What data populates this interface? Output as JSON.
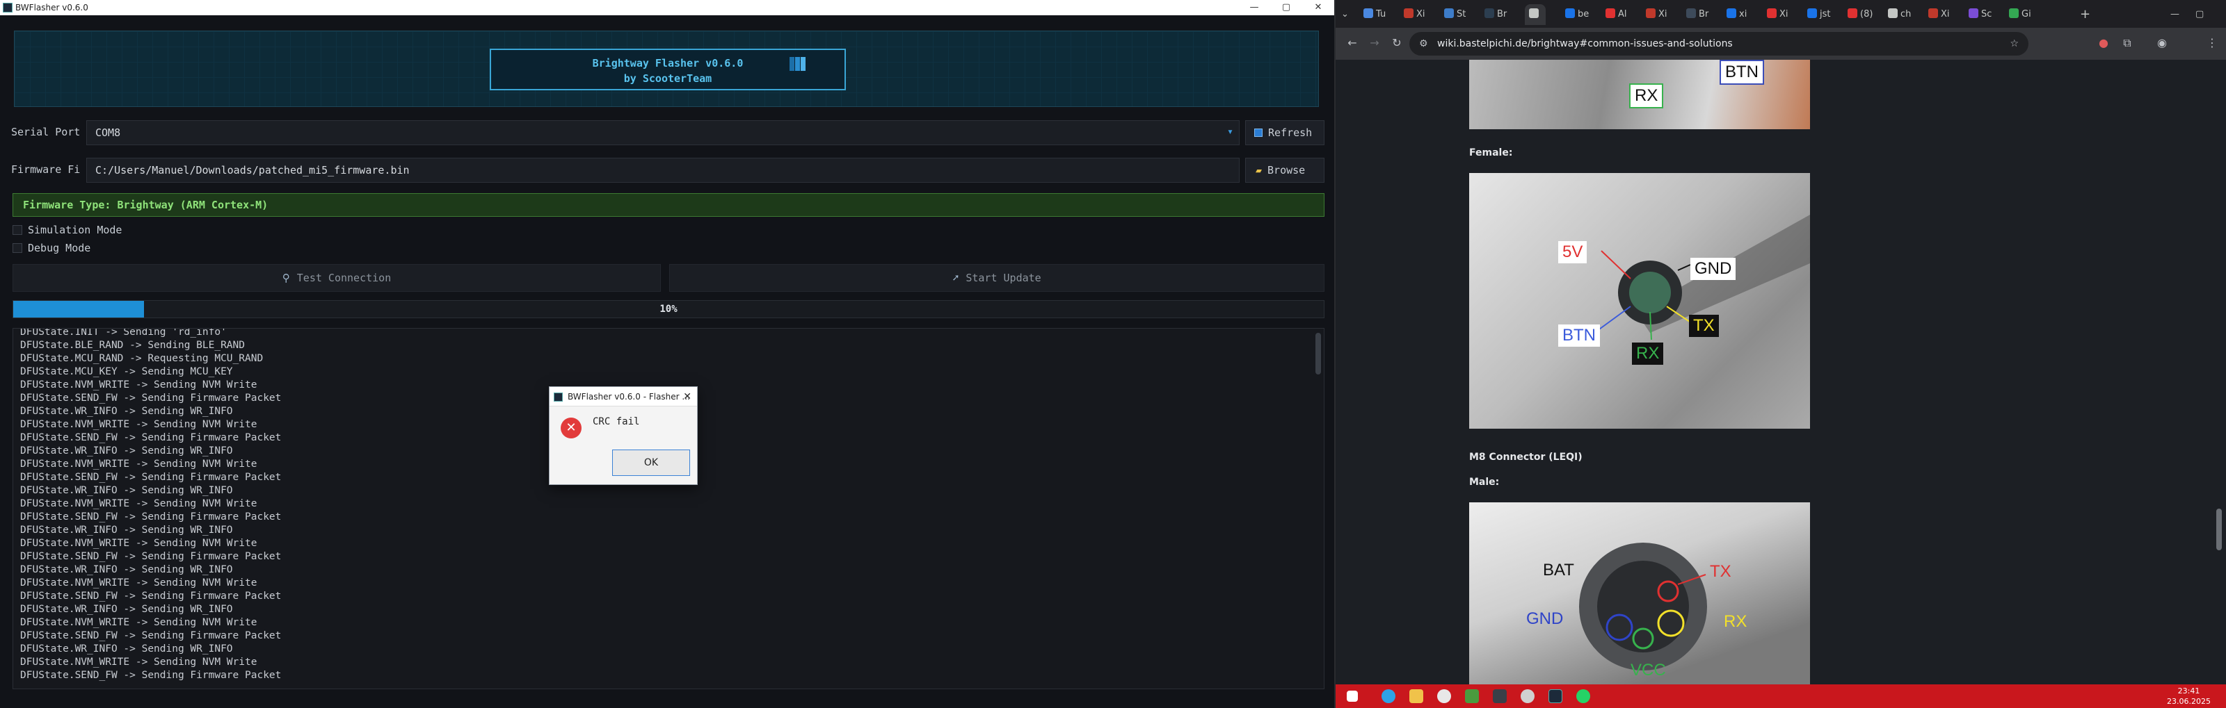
{
  "app": {
    "title": "BWFlasher v0.6.0",
    "banner_line1": "Brightway Flasher v0.6.0",
    "banner_line2": "by ScooterTeam",
    "serial_label": "Serial Port",
    "serial_value": "COM8",
    "refresh_label": "Refresh",
    "firmware_label": "Firmware Fi",
    "firmware_value": "C:/Users/Manuel/Downloads/patched_mi5_firmware.bin",
    "browse_label": "Browse",
    "firmware_type": "Firmware Type: Brightway (ARM Cortex-M)",
    "simulation_label": "Simulation Mode",
    "debug_label": "Debug Mode",
    "test_label": "Test Connection",
    "update_label": "Start Update",
    "progress_percent": 10,
    "progress_text": "10%",
    "log": [
      "DFUState.INIT -> Sending 'rd_info'",
      "DFUState.BLE_RAND -> Sending BLE_RAND",
      "DFUState.MCU_RAND -> Requesting MCU_RAND",
      "DFUState.MCU_KEY -> Sending MCU_KEY",
      "DFUState.NVM_WRITE -> Sending NVM Write",
      "DFUState.SEND_FW -> Sending Firmware Packet",
      "DFUState.WR_INFO -> Sending WR_INFO",
      "DFUState.NVM_WRITE -> Sending NVM Write",
      "DFUState.SEND_FW -> Sending Firmware Packet",
      "DFUState.WR_INFO -> Sending WR_INFO",
      "DFUState.NVM_WRITE -> Sending NVM Write",
      "DFUState.SEND_FW -> Sending Firmware Packet",
      "DFUState.WR_INFO -> Sending WR_INFO",
      "DFUState.NVM_WRITE -> Sending NVM Write",
      "DFUState.SEND_FW -> Sending Firmware Packet",
      "DFUState.WR_INFO -> Sending WR_INFO",
      "DFUState.NVM_WRITE -> Sending NVM Write",
      "DFUState.SEND_FW -> Sending Firmware Packet",
      "DFUState.WR_INFO -> Sending WR_INFO",
      "DFUState.NVM_WRITE -> Sending NVM Write",
      "DFUState.SEND_FW -> Sending Firmware Packet",
      "DFUState.WR_INFO -> Sending WR_INFO",
      "DFUState.NVM_WRITE -> Sending NVM Write",
      "DFUState.SEND_FW -> Sending Firmware Packet",
      "DFUState.WR_INFO -> Sending WR_INFO",
      "DFUState.NVM_WRITE -> Sending NVM Write",
      "DFUState.SEND_FW -> Sending Firmware Packet"
    ],
    "dialog": {
      "title": "BWFlasher v0.6.0 - Flasher ...",
      "message": "CRC fail",
      "ok_label": "OK"
    }
  },
  "browser": {
    "tabs": [
      "Tu",
      "Xi",
      "St",
      "Br",
      "",
      "be",
      "Al",
      "Xi",
      "Br",
      "xi",
      "Xi",
      "jst",
      "(8)",
      "ch",
      "Xi",
      "Sc",
      "Gi"
    ],
    "url": "wiki.bastelpichi.de/brightway#common-issues-and-solutions",
    "page": {
      "female_heading": "Female:",
      "m8_heading": "M8 Connector (LEQI)",
      "male_heading": "Male:",
      "top_labels": [
        "RX",
        "BTN"
      ],
      "female_labels": [
        "5V",
        "GND",
        "BTN",
        "TX",
        "RX"
      ],
      "male_labels": [
        "BAT",
        "TX",
        "GND",
        "RX",
        "VCC"
      ]
    }
  },
  "taskbar": {
    "time": "23:41",
    "date": "23.06.2025"
  }
}
